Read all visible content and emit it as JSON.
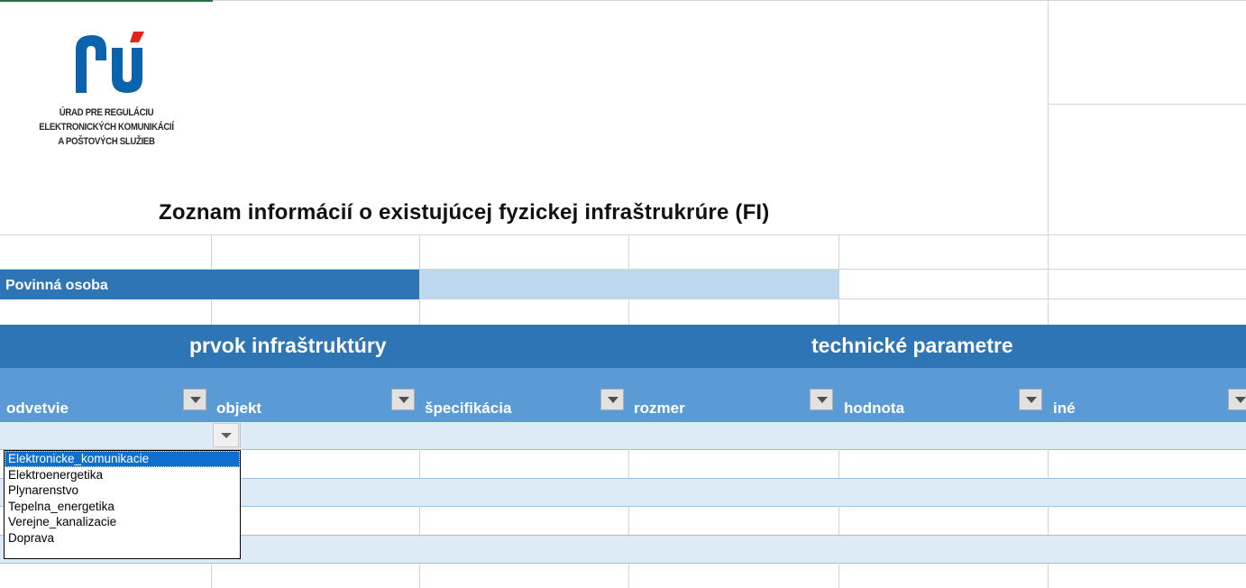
{
  "org": {
    "lines": [
      "ÚRAD PRE REGULÁCIU",
      "ELEKTRONICKÝCH KOMUNIKÁCIÍ",
      "A POŠTOVÝCH SLUŽIEB"
    ],
    "logo_colors": {
      "blue": "#0b63ae",
      "red": "#e2231a"
    }
  },
  "title": "Zoznam informácií o existujúcej fyzickej infraštrukrúre (FI)",
  "povinna": {
    "label": "Povinná osoba",
    "value": ""
  },
  "sections": {
    "left": "prvok infraštruktúry",
    "right": "technické parametre"
  },
  "columns": [
    {
      "label": "odvetvie"
    },
    {
      "label": "objekt"
    },
    {
      "label": "špecifikácia"
    },
    {
      "label": "rozmer"
    },
    {
      "label": "hodnota"
    },
    {
      "label": "iné"
    }
  ],
  "dropdown": {
    "options": [
      "Elektronicke_komunikacie",
      "Elektroenergetika",
      "Plynarenstvo",
      "Tepelna_energetika",
      "Verejne_kanalizacie",
      "Doprava"
    ],
    "selected_index": 0
  },
  "colors": {
    "header_dark": "#2e75b6",
    "header_light": "#5b9bd5",
    "row_band": "#ddebf7",
    "input_fill": "#bdd7ee"
  }
}
